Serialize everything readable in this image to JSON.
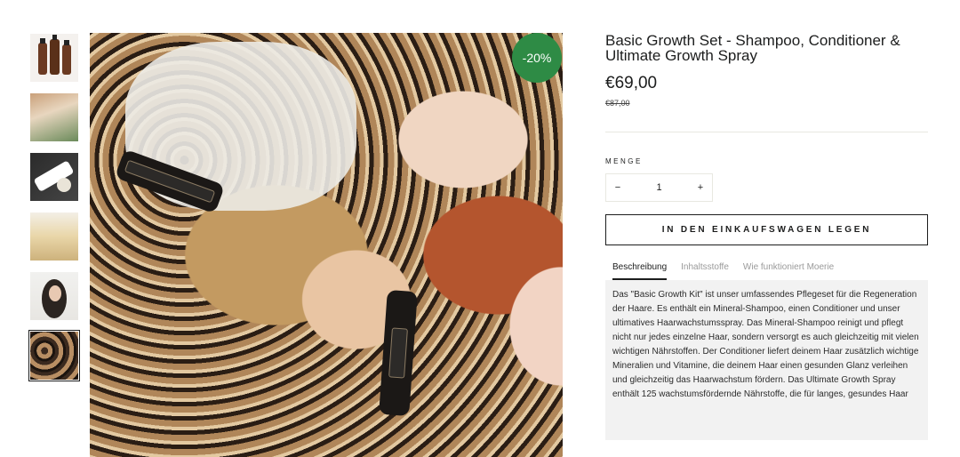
{
  "gallery": {
    "thumbnails": [
      {
        "alt": "product-bottles"
      },
      {
        "alt": "hair-salon"
      },
      {
        "alt": "product-black"
      },
      {
        "alt": "blonde-hair"
      },
      {
        "alt": "woman-portrait"
      },
      {
        "alt": "group-hair"
      }
    ],
    "discount_badge": "-20%"
  },
  "product": {
    "title": "Basic Growth Set - Shampoo, Conditioner & Ultimate Growth Spray",
    "price": "€69,00",
    "compare_price": "€87,00",
    "quantity_label": "MENGE",
    "quantity": "1",
    "minus": "−",
    "plus": "+",
    "add_to_cart": "IN DEN EINKAUFSWAGEN LEGEN"
  },
  "tabs": [
    {
      "label": "Beschreibung"
    },
    {
      "label": "Inhaltsstoffe"
    },
    {
      "label": "Wie funktioniert Moerie"
    }
  ],
  "description": "Das \"Basic Growth Kit\" ist unser umfassendes Pflegeset für die Regeneration der Haare. Es enthält ein Mineral-Shampoo, einen Conditioner und unser ultimatives Haarwachstumsspray. Das Mineral-Shampoo reinigt und pflegt nicht nur jedes einzelne Haar, sondern versorgt es auch gleichzeitig mit vielen wichtigen Nährstoffen. Der Conditioner liefert deinem Haar zusätzlich wichtige Mineralien und Vitamine, die deinem Haar einen gesunden Glanz verleihen und gleichzeitig das Haarwachstum fördern. Das Ultimate Growth Spray enthält 125 wachstumsfördernde Nährstoffe, die für langes, gesundes Haar",
  "colors": {
    "badge": "#2e8b45",
    "text": "#1c1d1d",
    "description_bg": "#f2f2f2"
  }
}
